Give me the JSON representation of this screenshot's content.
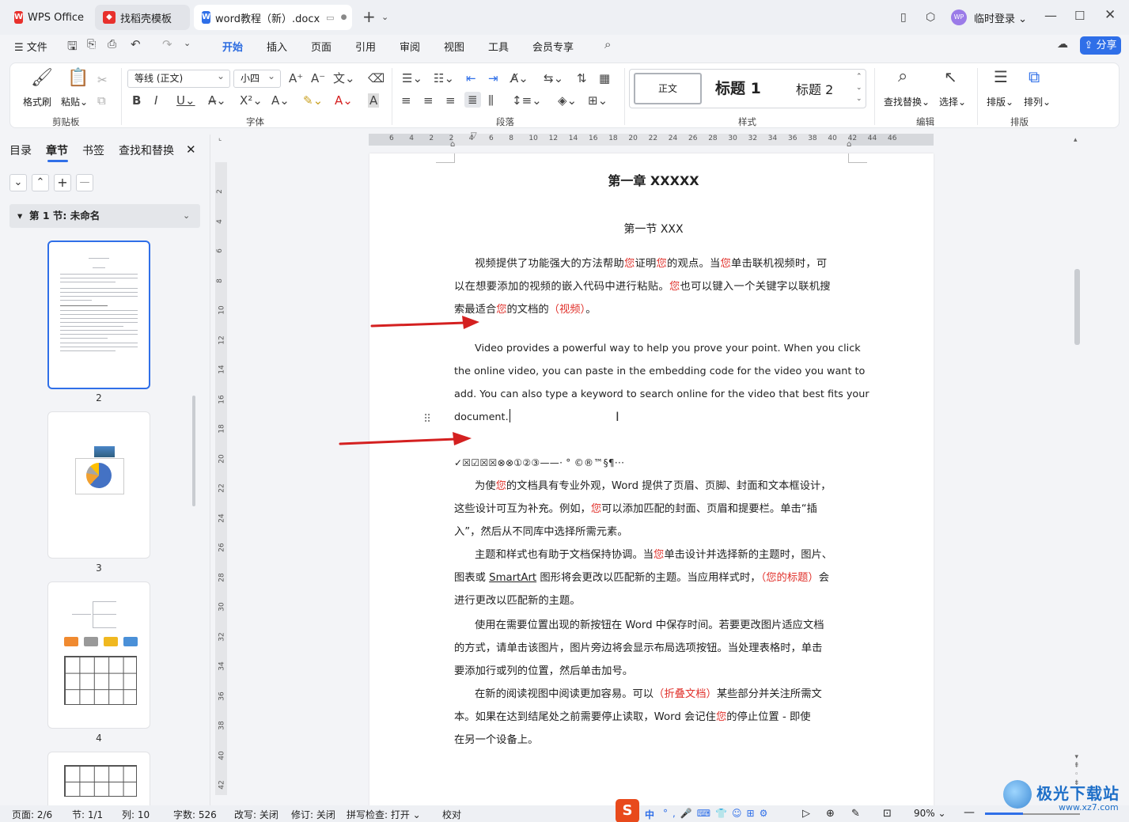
{
  "tabs": [
    {
      "label": "WPS Office",
      "icon": "wps-logo-icon"
    },
    {
      "label": "找稻壳模板",
      "icon": "docer-icon"
    },
    {
      "label": "word教程（新）.docx",
      "icon": "word-doc-icon"
    }
  ],
  "window": {
    "login_label": "临时登录",
    "avatar_text": "WP"
  },
  "menu": {
    "file": "文件",
    "items": [
      "开始",
      "插入",
      "页面",
      "引用",
      "审阅",
      "视图",
      "工具",
      "会员专享"
    ],
    "active": "开始",
    "share": "分享"
  },
  "ribbon": {
    "format_painter": "格式刷",
    "paste": "粘贴",
    "font_name": "等线 (正文)",
    "font_size": "小四",
    "styles": {
      "normal": "正文",
      "h1": "标题 1",
      "h2": "标题 2"
    },
    "find_replace": "查找替换",
    "select": "选择",
    "layout": "排版",
    "arrange": "排列",
    "groups": [
      "剪贴板",
      "字体",
      "段落",
      "样式",
      "编辑",
      "排版"
    ]
  },
  "leftpanel": {
    "tabs": [
      "目录",
      "章节",
      "书签",
      "查找和替换"
    ],
    "active_tab": "章节",
    "section_title": "第 1 节: 未命名",
    "page_numbers": [
      "2",
      "3",
      "4"
    ]
  },
  "ruler": {
    "h_ticks": [
      "6",
      "4",
      "2",
      "2",
      "4",
      "6",
      "8",
      "10",
      "12",
      "14",
      "16",
      "18",
      "20",
      "22",
      "24",
      "26",
      "28",
      "30",
      "32",
      "34",
      "36",
      "38",
      "40",
      "42",
      "44",
      "46"
    ],
    "v_ticks": [
      "2",
      "4",
      "6",
      "8",
      "10",
      "12",
      "14",
      "16",
      "18",
      "20",
      "22",
      "24",
      "26",
      "28",
      "30",
      "32",
      "34",
      "36",
      "38",
      "40",
      "42"
    ]
  },
  "document": {
    "chapter": "第一章 XXXXX",
    "section": "第一节 XXX",
    "p1": [
      [
        "视频提供了功能强大的方法帮助",
        "您",
        "证明",
        "您",
        "的观点。当",
        "您",
        "单击联机视频时，可"
      ],
      [
        "以在想要添加的视频的嵌入代码中进行粘贴。",
        "您",
        "也可以键入一个关键字以联机搜"
      ],
      [
        "索最适合",
        "您",
        "的文档的",
        "（视频）",
        "。"
      ]
    ],
    "p2": [
      "Video provides a powerful way to help you prove your point. When you click",
      "the online video, you can paste in the embedding code for the video you want to",
      "add. You can also type a keyword to search online for the video that best fits your",
      "document."
    ],
    "symbols": "✓☒☑☒☒⊗⊗①②③——·    °    ©®™§¶···",
    "p3": [
      [
        "为使",
        "您",
        "的文档具有专业外观，Word 提供了页眉、页脚、封面和文本框设计，"
      ],
      [
        "这些设计可互为补充。例如，",
        "您",
        "可以添加匹配的封面、页眉和提要栏。单击“插"
      ],
      [
        "入”，然后从不同库中选择所需元素。"
      ]
    ],
    "p4": [
      [
        "主题和样式也有助于文档保持协调。当",
        "您",
        "单击设计并选择新的主题时，图片、"
      ],
      [
        "图表或 ",
        "SmartArt",
        " 图形将会更改以匹配新的主题。当应用样式时，",
        "（您的标题）",
        "会"
      ],
      [
        "进行更改以匹配新的主题。"
      ]
    ],
    "p5": [
      "使用在需要位置出现的新按钮在 Word 中保存时间。若要更改图片适应文档",
      "的方式，请单击该图片，图片旁边将会显示布局选项按钮。当处理表格时，单击",
      "要添加行或列的位置，然后单击加号。"
    ],
    "p6": [
      [
        "在新的阅读视图中阅读更加容易。可以",
        "（折叠文档）",
        "某些部分并关注所需文"
      ],
      [
        "本。如果在达到结尾处之前需要停止读取，Word 会记住",
        "您",
        "的停止位置 - 即使"
      ],
      [
        "在另一个设备上。"
      ]
    ]
  },
  "statusbar": {
    "page": "页面: 2/6",
    "section": "节: 1/1",
    "column": "列: 10",
    "words": "字数: 526",
    "overtype": "改写: 关闭",
    "track": "修订: 关闭",
    "spell": "拼写检查: 打开",
    "proof": "校对",
    "zoom": "90%",
    "ime": "中"
  },
  "watermark": {
    "text": "极光下载站",
    "url": "www.xz7.com"
  },
  "colors": {
    "accent": "#2f6fe8",
    "red_text": "#e0302a",
    "arrow": "#d42020"
  }
}
